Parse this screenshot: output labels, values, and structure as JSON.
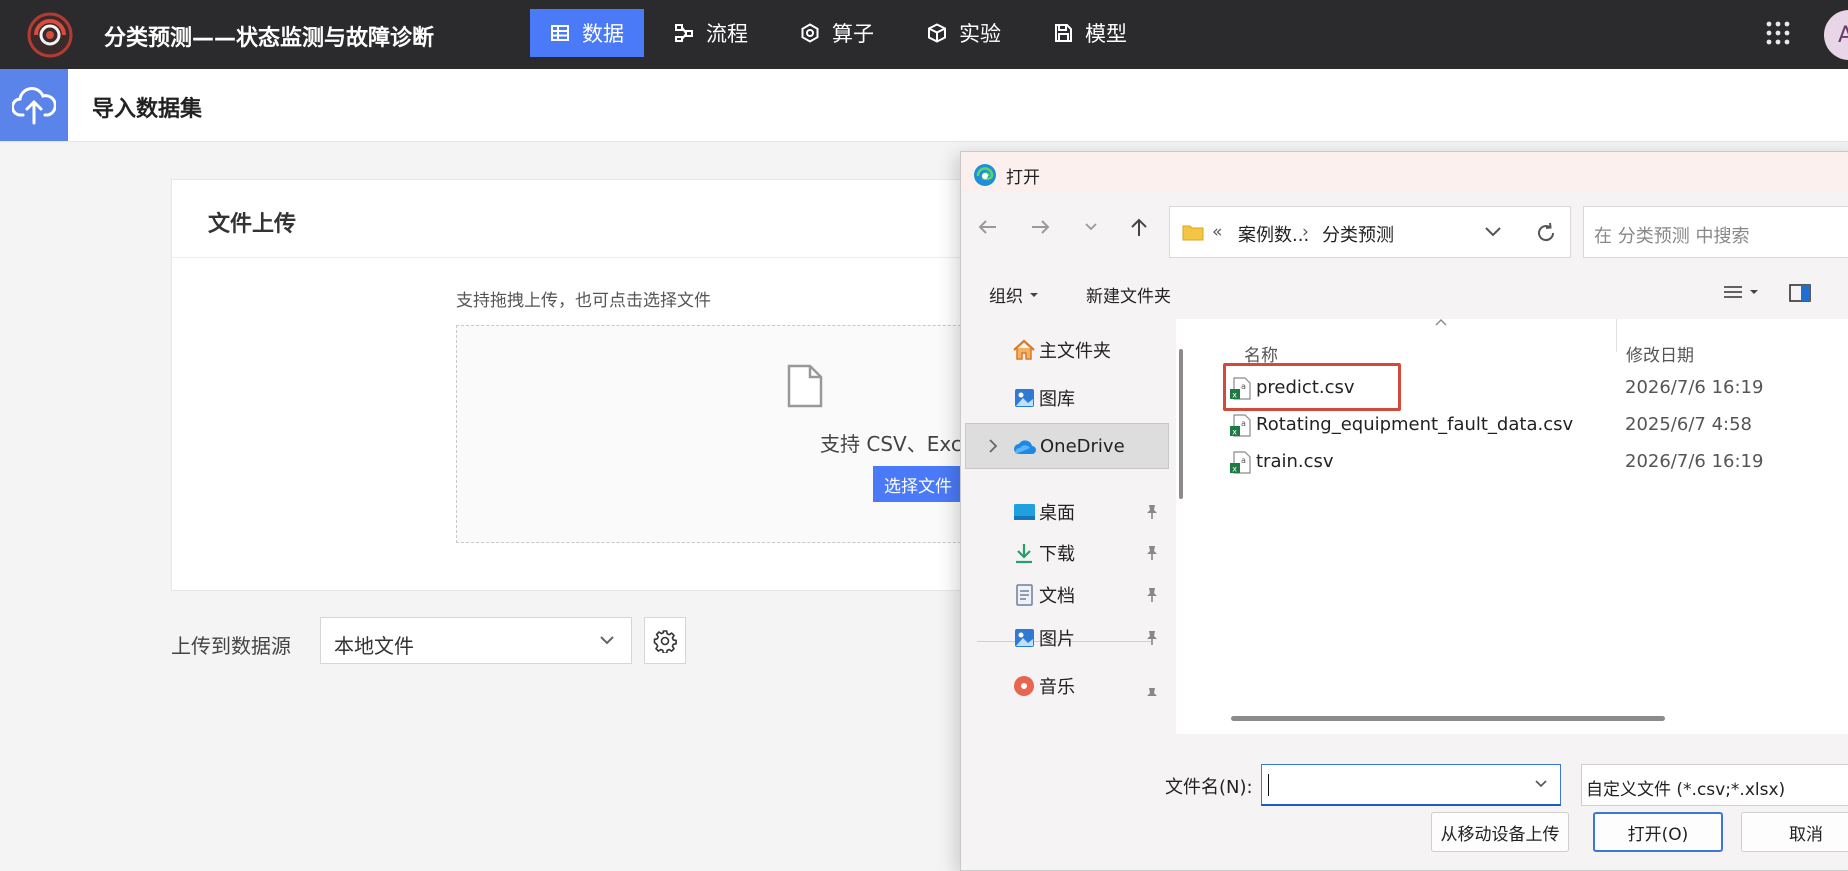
{
  "app": {
    "title": "分类预测——状态监测与故障诊断",
    "nav_tabs": [
      {
        "label": "数据",
        "icon": "table-icon",
        "active": true
      },
      {
        "label": "流程",
        "icon": "flow-icon",
        "active": false
      },
      {
        "label": "算子",
        "icon": "hexagon-icon",
        "active": false
      },
      {
        "label": "实验",
        "icon": "cube-icon",
        "active": false
      },
      {
        "label": "模型",
        "icon": "save-icon",
        "active": false
      }
    ],
    "avatar_initial": "A",
    "accent_color": "#4a7af7"
  },
  "page": {
    "title": "导入数据集"
  },
  "upload_card": {
    "title": "文件上传",
    "hint": "支持拖拽上传，也可点击选择文件",
    "support_text": "支持 CSV、Exce",
    "choose_button": "选择文件"
  },
  "datasource": {
    "label": "上传到数据源",
    "selected": "本地文件"
  },
  "dialog": {
    "title": "打开",
    "breadcrumb": {
      "overflow": "«",
      "parent": "案例数...",
      "separator": "›",
      "current": "分类预测"
    },
    "search_placeholder": "在 分类预测 中搜索",
    "toolbar": {
      "organize": "组织",
      "new_folder": "新建文件夹"
    },
    "nav_items": [
      {
        "label": "主文件夹",
        "icon": "home-icon"
      },
      {
        "label": "图库",
        "icon": "gallery-icon"
      },
      {
        "label": "OneDrive",
        "icon": "cloud-icon"
      },
      {
        "label": "桌面",
        "icon": "desktop-icon"
      },
      {
        "label": "下载",
        "icon": "download-icon"
      },
      {
        "label": "文档",
        "icon": "document-icon"
      },
      {
        "label": "图片",
        "icon": "picture-icon"
      },
      {
        "label": "音乐",
        "icon": "music-icon"
      }
    ],
    "columns": {
      "name": "名称",
      "modified": "修改日期"
    },
    "files": [
      {
        "name": "predict.csv",
        "modified": "2026/7/6 16:19"
      },
      {
        "name": "Rotating_equipment_fault_data.csv",
        "modified": "2025/6/7 4:58"
      },
      {
        "name": "train.csv",
        "modified": "2026/7/6 16:19"
      }
    ],
    "filename_label": "文件名(N):",
    "filename_value": "",
    "filetype": "自定义文件 (*.csv;*.xlsx)",
    "buttons": {
      "mobile_upload": "从移动设备上传",
      "open": "打开(O)",
      "cancel": "取消"
    }
  }
}
